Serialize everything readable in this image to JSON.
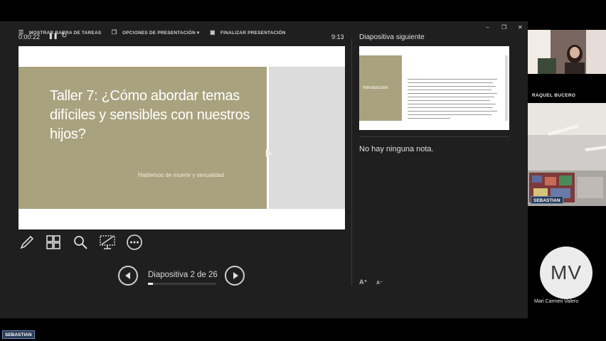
{
  "toolbar": {
    "taskbar_label": "MOSTRAR BARRA DE TAREAS",
    "options_label": "OPCIONES DE PRESENTACIÓN ▾",
    "end_label": "FINALIZAR PRESENTACIÓN",
    "minimize_glyph": "–",
    "restore_glyph": "❐",
    "close_glyph": "✕"
  },
  "presenter": {
    "timer": "0:00:22",
    "pause_glyph": "❚❚",
    "reset_glyph": "↻",
    "clock": "9:13",
    "next_slide_label": "Diapositiva siguiente",
    "notes_text": "No hay ninguna nota.",
    "slide_counter": "Diapositiva 2 de 26",
    "progress_fraction": 0.077,
    "font_up_glyph": "A⁺",
    "font_down_glyph": "A⁻"
  },
  "current_slide": {
    "title": "Taller 7: ¿Cómo abordar temas difíciles y sensibles con nuestros hijos?",
    "subtitle": "Hablemos de muerte y sexualidad",
    "band_color": "#a9a27e"
  },
  "next_slide": {
    "box_label": "Introducción"
  },
  "tools": [
    "pen-icon",
    "see-all-slides-icon",
    "zoom-icon",
    "screen-icon",
    "more-options-icon"
  ],
  "participants": {
    "raquel": "RAQUEL BUCERO",
    "sebastian": "SEBASTIAN",
    "mv_initials": "MV",
    "mv_name": "Mari Carmen Valero",
    "bottom_tag": "SEBASTIAN"
  }
}
